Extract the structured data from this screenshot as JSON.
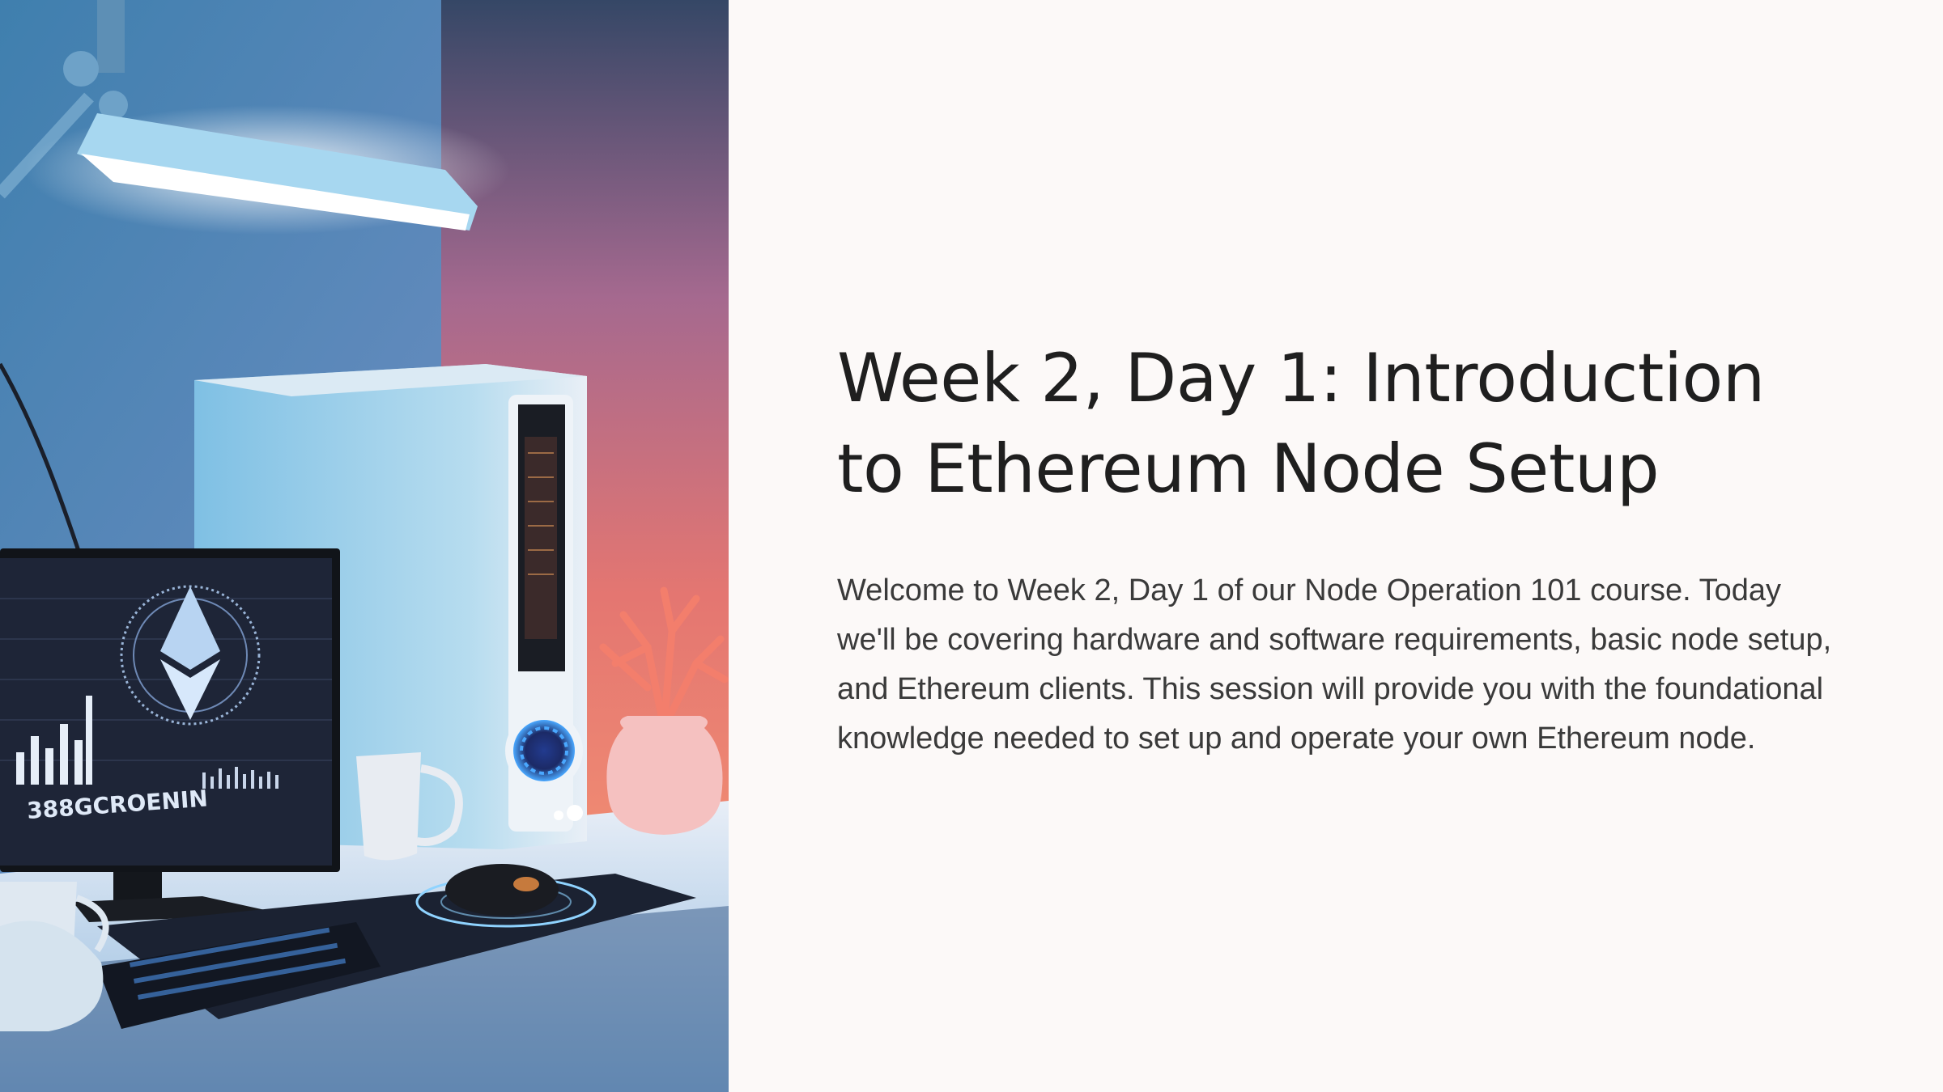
{
  "slide": {
    "title": "Week 2, Day 1: Introduction to Ethereum Node Setup",
    "body": "Welcome to Week 2, Day 1 of our Node Operation 101 course. Today we'll be covering hardware and software requirements, basic node setup, and Ethereum clients. This session will provide you with the foundational knowledge needed to set up and operate your own Ethereum node."
  },
  "photo": {
    "monitor_text": "388GCROENIN"
  },
  "colors": {
    "background": "#fcf9f8",
    "title": "#1f1f1f",
    "body": "#3a3a3a",
    "accent_blue": "#3aa0ff",
    "accent_coral": "#ef7f6a"
  }
}
